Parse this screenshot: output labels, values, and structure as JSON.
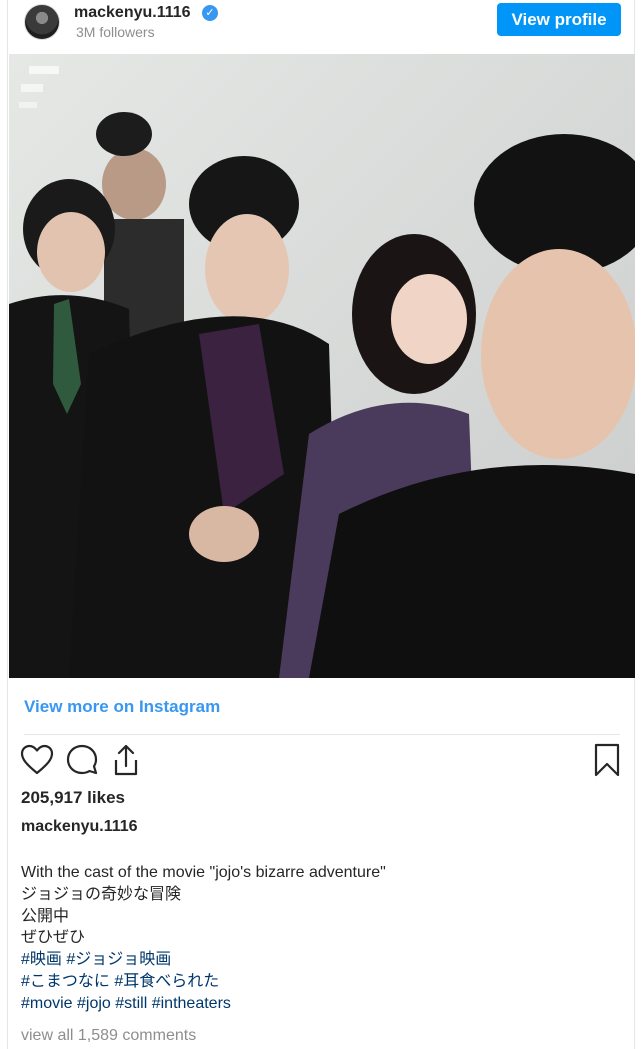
{
  "header": {
    "username": "mackenyu.1116",
    "verified_mark": "✓",
    "followers": "3M followers",
    "view_profile_label": "View profile"
  },
  "photo": {
    "description_icon": "group-selfie-photo"
  },
  "links": {
    "view_more": "View more on Instagram"
  },
  "actions": {
    "like": "heart-icon",
    "comment": "comment-icon",
    "share": "share-icon",
    "save": "bookmark-icon"
  },
  "likes": "205,917 likes",
  "caption": {
    "username": "mackenyu.1116",
    "lines": [
      "With the cast of the movie \"jojo's bizarre adventure\"",
      "ジョジョの奇妙な冒険",
      "公開中",
      "ぜひぜひ"
    ],
    "hashtag_lines": [
      "#映画 #ジョジョ映画",
      "#こまつなに #耳食べられた",
      "#movie #jojo #still #intheaters"
    ]
  },
  "comments": {
    "view_all": "view all 1,589 comments"
  },
  "colors": {
    "accent": "#0095f6",
    "link": "#3897f0",
    "hashtag": "#00376b",
    "muted": "#8e8e8e"
  }
}
